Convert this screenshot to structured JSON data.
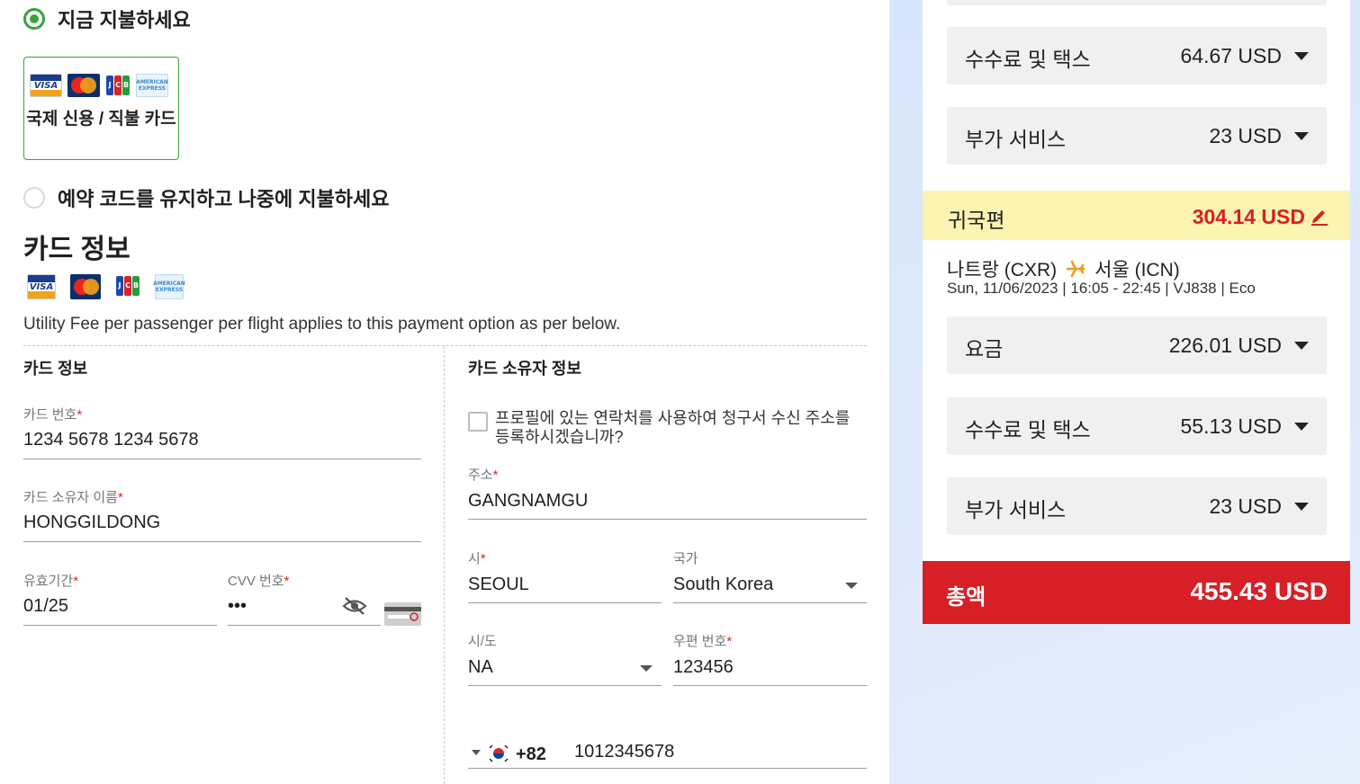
{
  "payment": {
    "pay_now_label": "지금 지불하세요",
    "card_option_label": "국제 신용 / 직불 카드",
    "pay_later_label": "예약 코드를 유지하고 나중에 지불하세요",
    "card_brands": [
      "VISA",
      "MasterCard",
      "JCB",
      "AMERICAN EXPRESS"
    ]
  },
  "card_section": {
    "title": "카드 정보",
    "utility_note": "Utility Fee per passenger per flight applies to this payment option as per below.",
    "left_col_title": "카드 정보",
    "right_col_title": "카드 소유자 정보",
    "card_number": {
      "label": "카드 번호",
      "value": "1234 5678 1234 5678"
    },
    "holder_name": {
      "label": "카드 소유자 이름",
      "value": "HONGGILDONG"
    },
    "expiry": {
      "label": "유효기간",
      "value": "01/25"
    },
    "cvv": {
      "label": "CVV 번호",
      "value": "•••"
    },
    "use_profile_label": "프로필에 있는 연락처를 사용하여 청구서 수신 주소를 등록하시겠습니까?",
    "address": {
      "label": "주소",
      "value": "GANGNAMGU"
    },
    "city": {
      "label": "시",
      "value": "SEOUL"
    },
    "country": {
      "label": "국가",
      "value": "South Korea"
    },
    "state": {
      "label": "시/도",
      "value": "NA"
    },
    "postal": {
      "label": "우편 번호",
      "value": "123456"
    },
    "phone": {
      "code": "+82",
      "number": "1012345678"
    },
    "required_mark": "*"
  },
  "summary": {
    "outbound_fees": {
      "label": "수수료 및 택스",
      "value": "64.67 USD"
    },
    "outbound_addons": {
      "label": "부가 서비스",
      "value": "23 USD"
    },
    "return": {
      "label": "귀국편",
      "value": "304.14 USD"
    },
    "route": {
      "from": "나트랑 (CXR)",
      "to": "서울 (ICN)"
    },
    "flight_info": "Sun, 11/06/2023 | 16:05 - 22:45 | VJ838 | Eco",
    "return_fare": {
      "label": "요금",
      "value": "226.01 USD"
    },
    "return_fees": {
      "label": "수수료 및 택스",
      "value": "55.13 USD"
    },
    "return_addons": {
      "label": "부가 서비스",
      "value": "23 USD"
    },
    "total": {
      "label": "총액",
      "value": "455.43 USD"
    }
  },
  "colors": {
    "accent_green": "#37a33b",
    "brand_red": "#d61f26",
    "highlight_yellow": "#fbf3b0"
  }
}
